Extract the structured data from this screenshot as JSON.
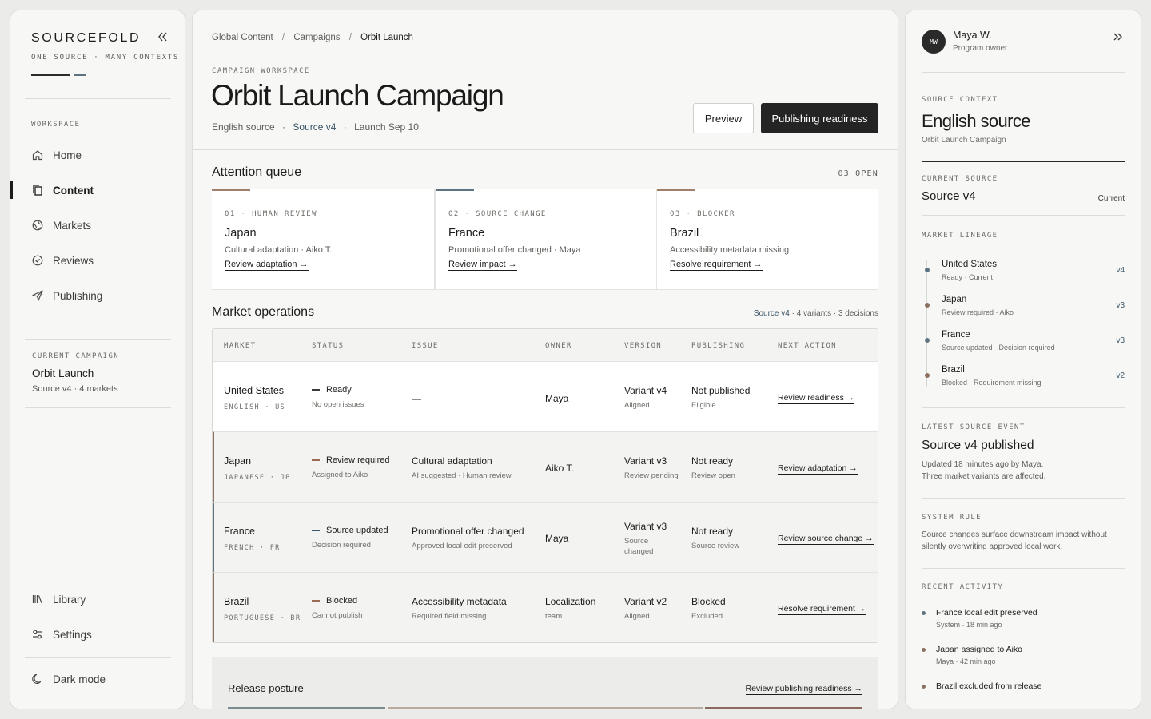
{
  "sidebar": {
    "brand": "SOURCEFOLD",
    "tagline": "ONE SOURCE · MANY CONTEXTS",
    "collapse_icon": "double-chevron-left-icon",
    "workspace_label": "WORKSPACE",
    "nav": [
      {
        "label": "Home",
        "icon": "home-icon"
      },
      {
        "label": "Content",
        "icon": "documents-icon",
        "active": true
      },
      {
        "label": "Markets",
        "icon": "globe-icon"
      },
      {
        "label": "Reviews",
        "icon": "check-circle-icon"
      },
      {
        "label": "Publishing",
        "icon": "send-icon"
      }
    ],
    "current_campaign_label": "CURRENT CAMPAIGN",
    "current_campaign_name": "Orbit Launch",
    "current_campaign_meta": "Source v4 · 4 markets",
    "library": "Library",
    "settings": "Settings",
    "dark_mode": "Dark mode"
  },
  "main": {
    "breadcrumb": [
      "Global Content",
      "Campaigns",
      "Orbit Launch"
    ],
    "breadcrumb_sep": "/",
    "eyebrow": "CAMPAIGN WORKSPACE",
    "title": "Orbit Launch Campaign",
    "meta": {
      "source": "English source",
      "version": "Source v4",
      "launch": "Launch Sep 10",
      "sep": "·"
    },
    "preview_label": "Preview",
    "readiness_label": "Publishing readiness",
    "attention": {
      "title": "Attention queue",
      "count": "03 OPEN",
      "cards": [
        {
          "tag": "01 · HUMAN REVIEW",
          "market": "Japan",
          "detail": "Cultural adaptation · Aiko T.",
          "action": "Review adaptation →",
          "accent": "#a0806c"
        },
        {
          "tag": "02 · SOURCE CHANGE",
          "market": "France",
          "detail": "Promotional offer changed · Maya",
          "action": "Review impact →",
          "accent": "#5e7382"
        },
        {
          "tag": "03 · BLOCKER",
          "market": "Brazil",
          "detail": "Accessibility metadata missing",
          "action": "Resolve requirement →",
          "accent": "#a0806c"
        }
      ]
    },
    "operations": {
      "title": "Market operations",
      "summary_version": "Source v4",
      "summary_rest": "· 4 variants · 3 decisions",
      "headers": [
        "MARKET",
        "STATUS",
        "ISSUE",
        "OWNER",
        "VERSION",
        "PUBLISHING",
        "NEXT ACTION"
      ],
      "rows": [
        {
          "market": "United States",
          "locale": "ENGLISH · US",
          "status": "Ready",
          "status_note": "No open issues",
          "status_color": "#3a3a38",
          "issue": "—",
          "issue_note": "",
          "owner": "Maya",
          "owner_note": "",
          "version": "Variant v4",
          "version_note": "Aligned",
          "publishing": "Not published",
          "publishing_note": "Eligible",
          "action": "Review readiness →"
        },
        {
          "market": "Japan",
          "locale": "JAPANESE · JP",
          "status": "Review required",
          "status_note": "Assigned to Aiko",
          "status_color": "#9b6a55",
          "issue": "Cultural adaptation",
          "issue_note": "AI suggested · Human review",
          "owner": "Aiko T.",
          "owner_note": "",
          "version": "Variant v3",
          "version_note": "Review pending",
          "publishing": "Not ready",
          "publishing_note": "Review open",
          "action": "Review adaptation →"
        },
        {
          "market": "France",
          "locale": "FRENCH · FR",
          "status": "Source updated",
          "status_note": "Decision required",
          "status_color": "#3c5668",
          "issue": "Promotional offer changed",
          "issue_note": "Approved local edit preserved",
          "owner": "Maya",
          "owner_note": "",
          "version": "Variant v3",
          "version_note": "Source",
          "version_note2": "changed",
          "publishing": "Not ready",
          "publishing_note": "Source review",
          "action": "Review source change →"
        },
        {
          "market": "Brazil",
          "locale": "PORTUGUESE · BR",
          "status": "Blocked",
          "status_note": "Cannot publish",
          "status_color": "#9b6a55",
          "issue": "Accessibility metadata",
          "issue_note": "Required field missing",
          "owner": "Localization",
          "owner_note": "team",
          "version": "Variant v2",
          "version_note": "Aligned",
          "publishing": "Blocked",
          "publishing_note": "Excluded",
          "action": "Resolve requirement →"
        }
      ]
    },
    "release": {
      "title": "Release posture",
      "action": "Review publishing readiness →"
    }
  },
  "right": {
    "user": {
      "initials": "MW",
      "name": "Maya W.",
      "role": "Program owner"
    },
    "expand_icon": "double-chevron-right-icon",
    "source_context_label": "SOURCE CONTEXT",
    "source_title": "English source",
    "source_campaign": "Orbit Launch Campaign",
    "current_source_label": "CURRENT SOURCE",
    "current_source": "Source v4",
    "current_badge": "Current",
    "lineage_label": "MARKET LINEAGE",
    "lineage": [
      {
        "market": "United States",
        "note": "Ready · Current",
        "version": "v4",
        "color": "#5e7382"
      },
      {
        "market": "Japan",
        "note": "Review required · Aiko",
        "version": "v3",
        "color": "#8a7160"
      },
      {
        "market": "France",
        "note": "Source updated · Decision required",
        "version": "v3",
        "color": "#5e7382"
      },
      {
        "market": "Brazil",
        "note": "Blocked · Requirement missing",
        "version": "v2",
        "color": "#8a7160"
      }
    ],
    "event_label": "LATEST SOURCE EVENT",
    "event_title": "Source v4 published",
    "event_line1": "Updated 18 minutes ago by Maya.",
    "event_line2": "Three market variants are affected.",
    "rule_label": "SYSTEM RULE",
    "rule_line1": "Source changes surface downstream impact without",
    "rule_line2": "silently overwriting approved local work.",
    "activity_label": "RECENT ACTIVITY",
    "activity": [
      {
        "title": "France local edit preserved",
        "meta": "System · 18 min ago",
        "color": "#5e7382"
      },
      {
        "title": "Japan assigned to Aiko",
        "meta": "Maya · 42 min ago",
        "color": "#8a7160"
      },
      {
        "title": "Brazil excluded from release",
        "meta": "",
        "color": "#8a7160"
      }
    ]
  }
}
